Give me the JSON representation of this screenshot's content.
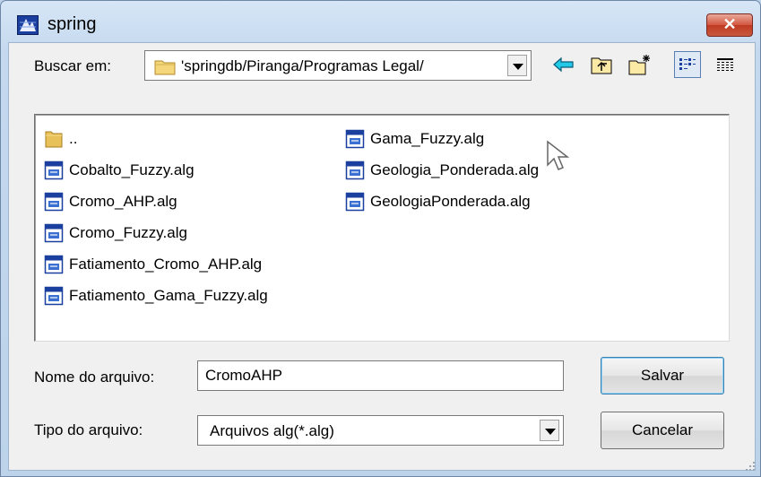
{
  "window": {
    "title": "spring",
    "close_label": "✕"
  },
  "toolbar": {
    "look_in_label": "Buscar em:",
    "look_in_path": "'springdb/Piranga/Programas Legal/",
    "icons": [
      "back-arrow-icon",
      "up-folder-icon",
      "new-folder-icon",
      "list-view-icon",
      "details-view-icon"
    ]
  },
  "files": {
    "column1": [
      {
        "name": "..",
        "type": "folder"
      },
      {
        "name": "Cobalto_Fuzzy.alg",
        "type": "alg"
      },
      {
        "name": "Cromo_AHP.alg",
        "type": "alg"
      },
      {
        "name": "Cromo_Fuzzy.alg",
        "type": "alg"
      },
      {
        "name": "Fatiamento_Cromo_AHP.alg",
        "type": "alg"
      },
      {
        "name": "Fatiamento_Gama_Fuzzy.alg",
        "type": "alg"
      }
    ],
    "column2": [
      {
        "name": "Gama_Fuzzy.alg",
        "type": "alg"
      },
      {
        "name": "Geologia_Ponderada.alg",
        "type": "alg"
      },
      {
        "name": "GeologiaPonderada.alg",
        "type": "alg"
      }
    ]
  },
  "filename": {
    "label": "Nome do arquivo:",
    "value": "CromoAHP"
  },
  "filetype": {
    "label": "Tipo do arquivo:",
    "value": "Arquivos alg(*.alg)"
  },
  "buttons": {
    "save": "Salvar",
    "cancel": "Cancelar"
  }
}
